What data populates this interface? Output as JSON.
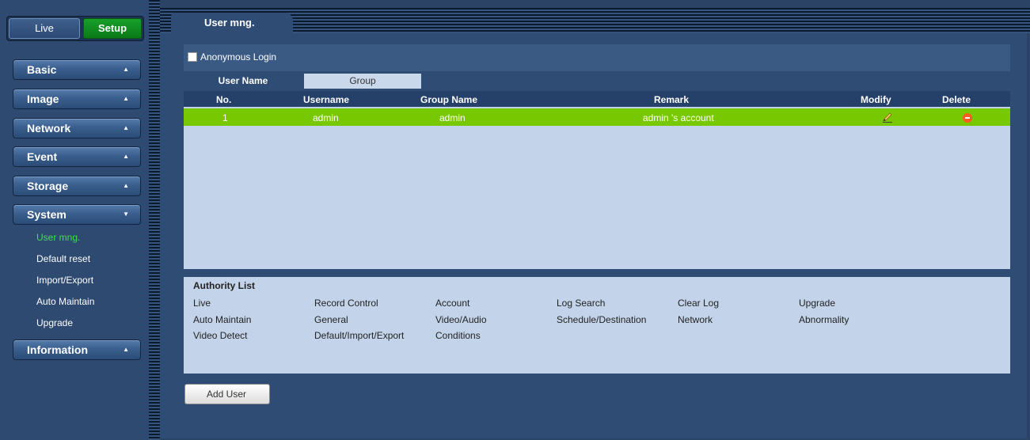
{
  "switch": {
    "live": "Live",
    "setup": "Setup"
  },
  "menu": {
    "basic": "Basic",
    "image": "Image",
    "network": "Network",
    "event": "Event",
    "storage": "Storage",
    "system": "System",
    "information": "Information",
    "arrow_up": "▲",
    "arrow_down": "▼"
  },
  "system_items": [
    "User mng.",
    "Default reset",
    "Import/Export",
    "Auto Maintain",
    "Upgrade"
  ],
  "tab_title": "User mng.",
  "anonymous_login": "Anonymous Login",
  "subtabs": {
    "user_name": "User Name",
    "group": "Group"
  },
  "table": {
    "headers": {
      "no": "No.",
      "username": "Username",
      "group_name": "Group Name",
      "remark": "Remark",
      "modify": "Modify",
      "delete": "Delete"
    },
    "rows": [
      {
        "no": "1",
        "username": "admin",
        "group_name": "admin",
        "remark": "admin 's account"
      }
    ]
  },
  "authority": {
    "title": "Authority List",
    "items": [
      "Live",
      "Record Control",
      "Account",
      "Log Search",
      "Clear Log",
      "Upgrade",
      "Auto Maintain",
      "General",
      "Video/Audio",
      "Schedule/Destination",
      "Network",
      "Abnormality",
      "Video Detect",
      "Default/Import/Export",
      "Conditions"
    ]
  },
  "add_user": "Add User",
  "colors": {
    "accent_green": "#78c800",
    "active_text": "#3ee04c",
    "setup_green": "#0b7a18"
  },
  "icons": {
    "modify": "pencil-icon",
    "delete": "remove-circle-icon"
  }
}
